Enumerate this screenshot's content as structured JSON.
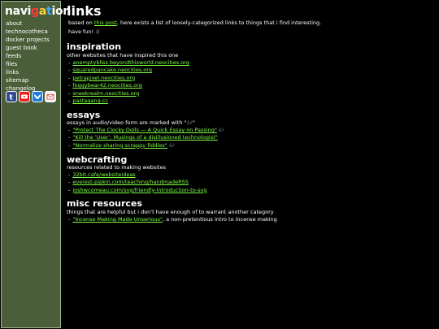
{
  "sidebar": {
    "logo_letters": [
      {
        "ch": "n",
        "color": "#ffffff"
      },
      {
        "ch": "a",
        "color": "#ffffff"
      },
      {
        "ch": "v",
        "color": "#ffffff"
      },
      {
        "ch": "i",
        "color": "#ffffff"
      },
      {
        "ch": "g",
        "color": "#ff3b3b"
      },
      {
        "ch": "a",
        "color": "#ffd23b"
      },
      {
        "ch": "t",
        "color": "#4aa8ff"
      },
      {
        "ch": "i",
        "color": "#ffffff"
      },
      {
        "ch": "o",
        "color": "#ffffff"
      },
      {
        "ch": "n",
        "color": "#ffffff"
      }
    ],
    "items": [
      "about",
      "technocotheca",
      "docker projects",
      "guest book",
      "feeds",
      "files",
      "links",
      "sitemap",
      "changelog"
    ],
    "social_icons": [
      "tumblr-icon",
      "youtube-icon",
      "bluesky-icon",
      "email-icon"
    ]
  },
  "page": {
    "title": "links",
    "intro_pre": "based on ",
    "intro_link": "this post",
    "intro_post": ", here exists a list of loosely-categorized links to things that i find interesting.",
    "have_fun": "have fun! :)"
  },
  "sections": {
    "inspiration": {
      "heading": "inspiration",
      "desc": "other websites that have inspired this one",
      "links": [
        "anemptybliss beyondthisworld.neocities.org",
        "squaredpancake.neocities.org",
        "petrapixel.neocities.org",
        "foggybear42.neocities.org",
        "sneekrealm.neocities.org",
        "pastagang.cc"
      ]
    },
    "essays": {
      "heading": "essays",
      "desc_pre": "essays in audio/video form are marked with \"",
      "desc_post": "\"",
      "links": [
        {
          "text": "\"Protect The Clocky Dolls — A Quick Essay on Passing\"",
          "av": true
        },
        {
          "text": "\"Kill the 'User': Musings of a disillusioned technologist\"",
          "av": false
        },
        {
          "text": "\"Normalize sharing scrappy fiddles\"",
          "av": true
        }
      ]
    },
    "webcrafting": {
      "heading": "webcrafting",
      "desc": "resources related to making websites",
      "links": [
        "32bit.cafe/websiteideas",
        "everest-pipkin.com/teaching/handmadeRSS",
        "joshwcomeau.com/svg/friendly-introduction-to-svg"
      ]
    },
    "misc": {
      "heading": "misc resources",
      "desc": "things that are helpful but i don't have enough of to warrant another category",
      "link": "\"Incense Making Made Unserious\"",
      "link_post": ", a non-pretentious intro to incense making"
    }
  }
}
